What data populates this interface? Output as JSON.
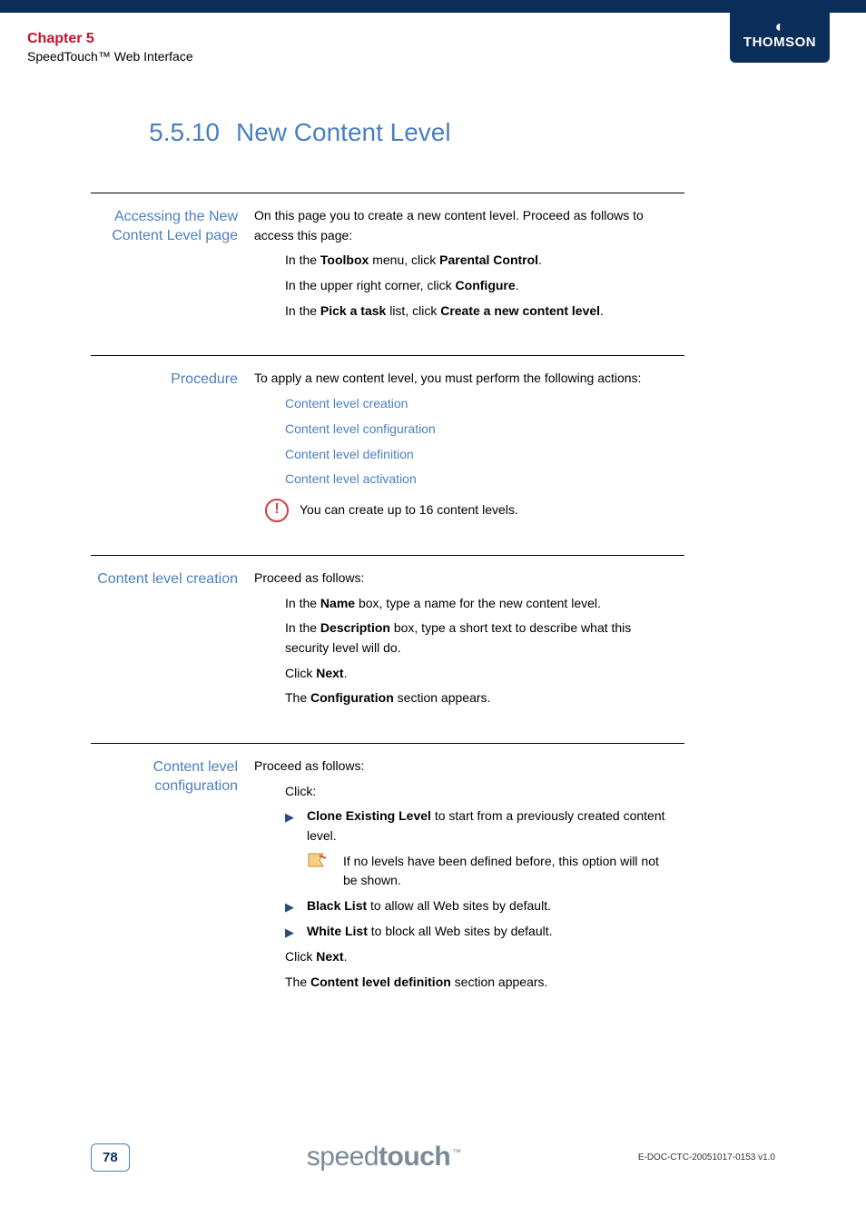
{
  "header": {
    "chapter": "Chapter 5",
    "subtitle": "SpeedTouch™ Web Interface",
    "brand": "THOMSON"
  },
  "title": {
    "number": "5.5.10",
    "text": "New Content Level"
  },
  "sections": {
    "accessing": {
      "label": "Accessing the New Content Level page",
      "intro": "On this page you to create a new content level. Proceed as follows to access this page:",
      "step1_pre": "In the ",
      "step1_b1": "Toolbox",
      "step1_mid": " menu, click ",
      "step1_b2": "Parental Control",
      "step1_end": ".",
      "step2_pre": "In the upper right corner, click ",
      "step2_b1": "Configure",
      "step2_end": ".",
      "step3_pre": "In the ",
      "step3_b1": "Pick a task",
      "step3_mid": " list, click ",
      "step3_b2": "Create a new content level",
      "step3_end": "."
    },
    "procedure": {
      "label": "Procedure",
      "intro": "To apply a new content level, you must perform the following actions:",
      "link1": "Content level creation",
      "link2": "Content level configuration",
      "link3": "Content level definition",
      "link4": "Content level activation",
      "note": "You can create up to 16 content levels."
    },
    "creation": {
      "label": "Content level creation",
      "intro": "Proceed as follows:",
      "s1_pre": "In the ",
      "s1_b1": "Name",
      "s1_end": " box, type a name for the new content level.",
      "s2_pre": "In the ",
      "s2_b1": "Description",
      "s2_end": " box, type a short text to describe what this security level will do.",
      "s3_pre": "Click ",
      "s3_b1": "Next",
      "s3_end": ".",
      "s4_pre": "The ",
      "s4_b1": "Configuration",
      "s4_end": " section appears."
    },
    "configuration": {
      "label": "Content level configuration",
      "intro": "Proceed as follows:",
      "click": "Click:",
      "b1_bold": "Clone Existing Level",
      "b1_rest": " to start from a previously created content level.",
      "b1_note": "If no levels have been defined before, this option will not be shown.",
      "b2_bold": "Black List",
      "b2_rest": " to allow all Web sites by default.",
      "b3_bold": "White List",
      "b3_rest": " to block all Web sites by default.",
      "s3_pre": "Click ",
      "s3_b1": "Next",
      "s3_end": ".",
      "s4_pre": "The ",
      "s4_b1": "Content level definition",
      "s4_end": " section appears."
    }
  },
  "footer": {
    "page": "78",
    "logo_light": "speed",
    "logo_heavy": "touch",
    "logo_tm": "™",
    "docid": "E-DOC-CTC-20051017-0153 v1.0"
  }
}
